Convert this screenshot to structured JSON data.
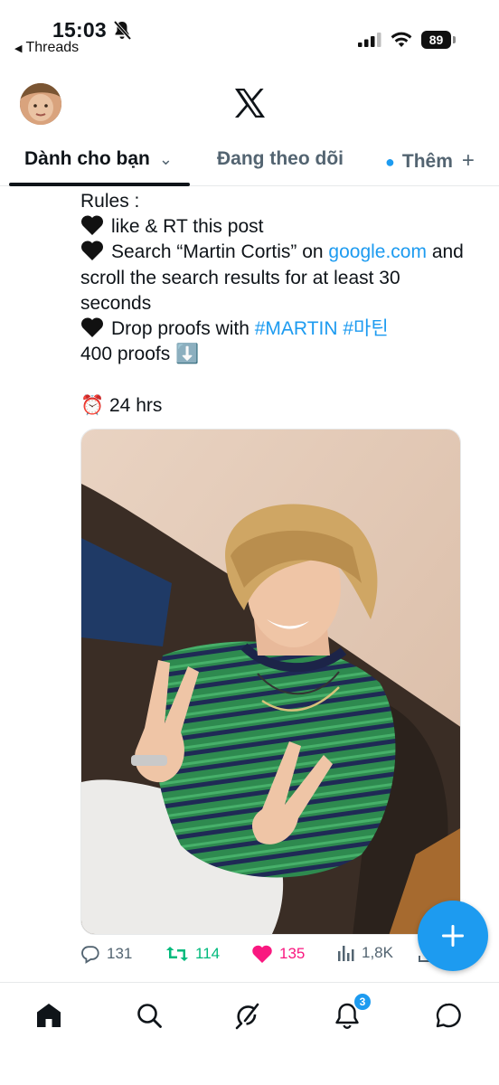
{
  "status_bar": {
    "time": "15:03",
    "back_app": "Threads",
    "battery": "89"
  },
  "tabs": [
    {
      "label": "Dành cho bạn",
      "active": true
    },
    {
      "label": "Đang theo dõi",
      "active": false
    },
    {
      "label": "Thêm",
      "active": false
    }
  ],
  "tweet": {
    "rules_heading": "Rules :",
    "rule_1": "like & RT this post",
    "rule_2_prefix": "Search “Martin Cortis” on ",
    "rule_2_link": "google.com",
    "rule_2_suffix": " and",
    "rule_2_line2": "scroll the search results for at least 30",
    "rule_2_line3": "seconds",
    "rule_3_prefix": "Drop proofs with ",
    "rule_3_hashtags": "#MARTIN #마틴",
    "proofs": "400 proofs",
    "proofs_emoji": "⬇️",
    "timer_emoji": "⏰",
    "timer": "24 hrs",
    "stats": {
      "replies": "131",
      "reposts": "114",
      "likes": "135",
      "views": "1,8K"
    }
  },
  "notifications_badge": "3",
  "colors": {
    "accent": "#1d9bf0",
    "repost": "#00ba7c",
    "like": "#f91880",
    "text": "#0f1419",
    "muted": "#536471"
  }
}
